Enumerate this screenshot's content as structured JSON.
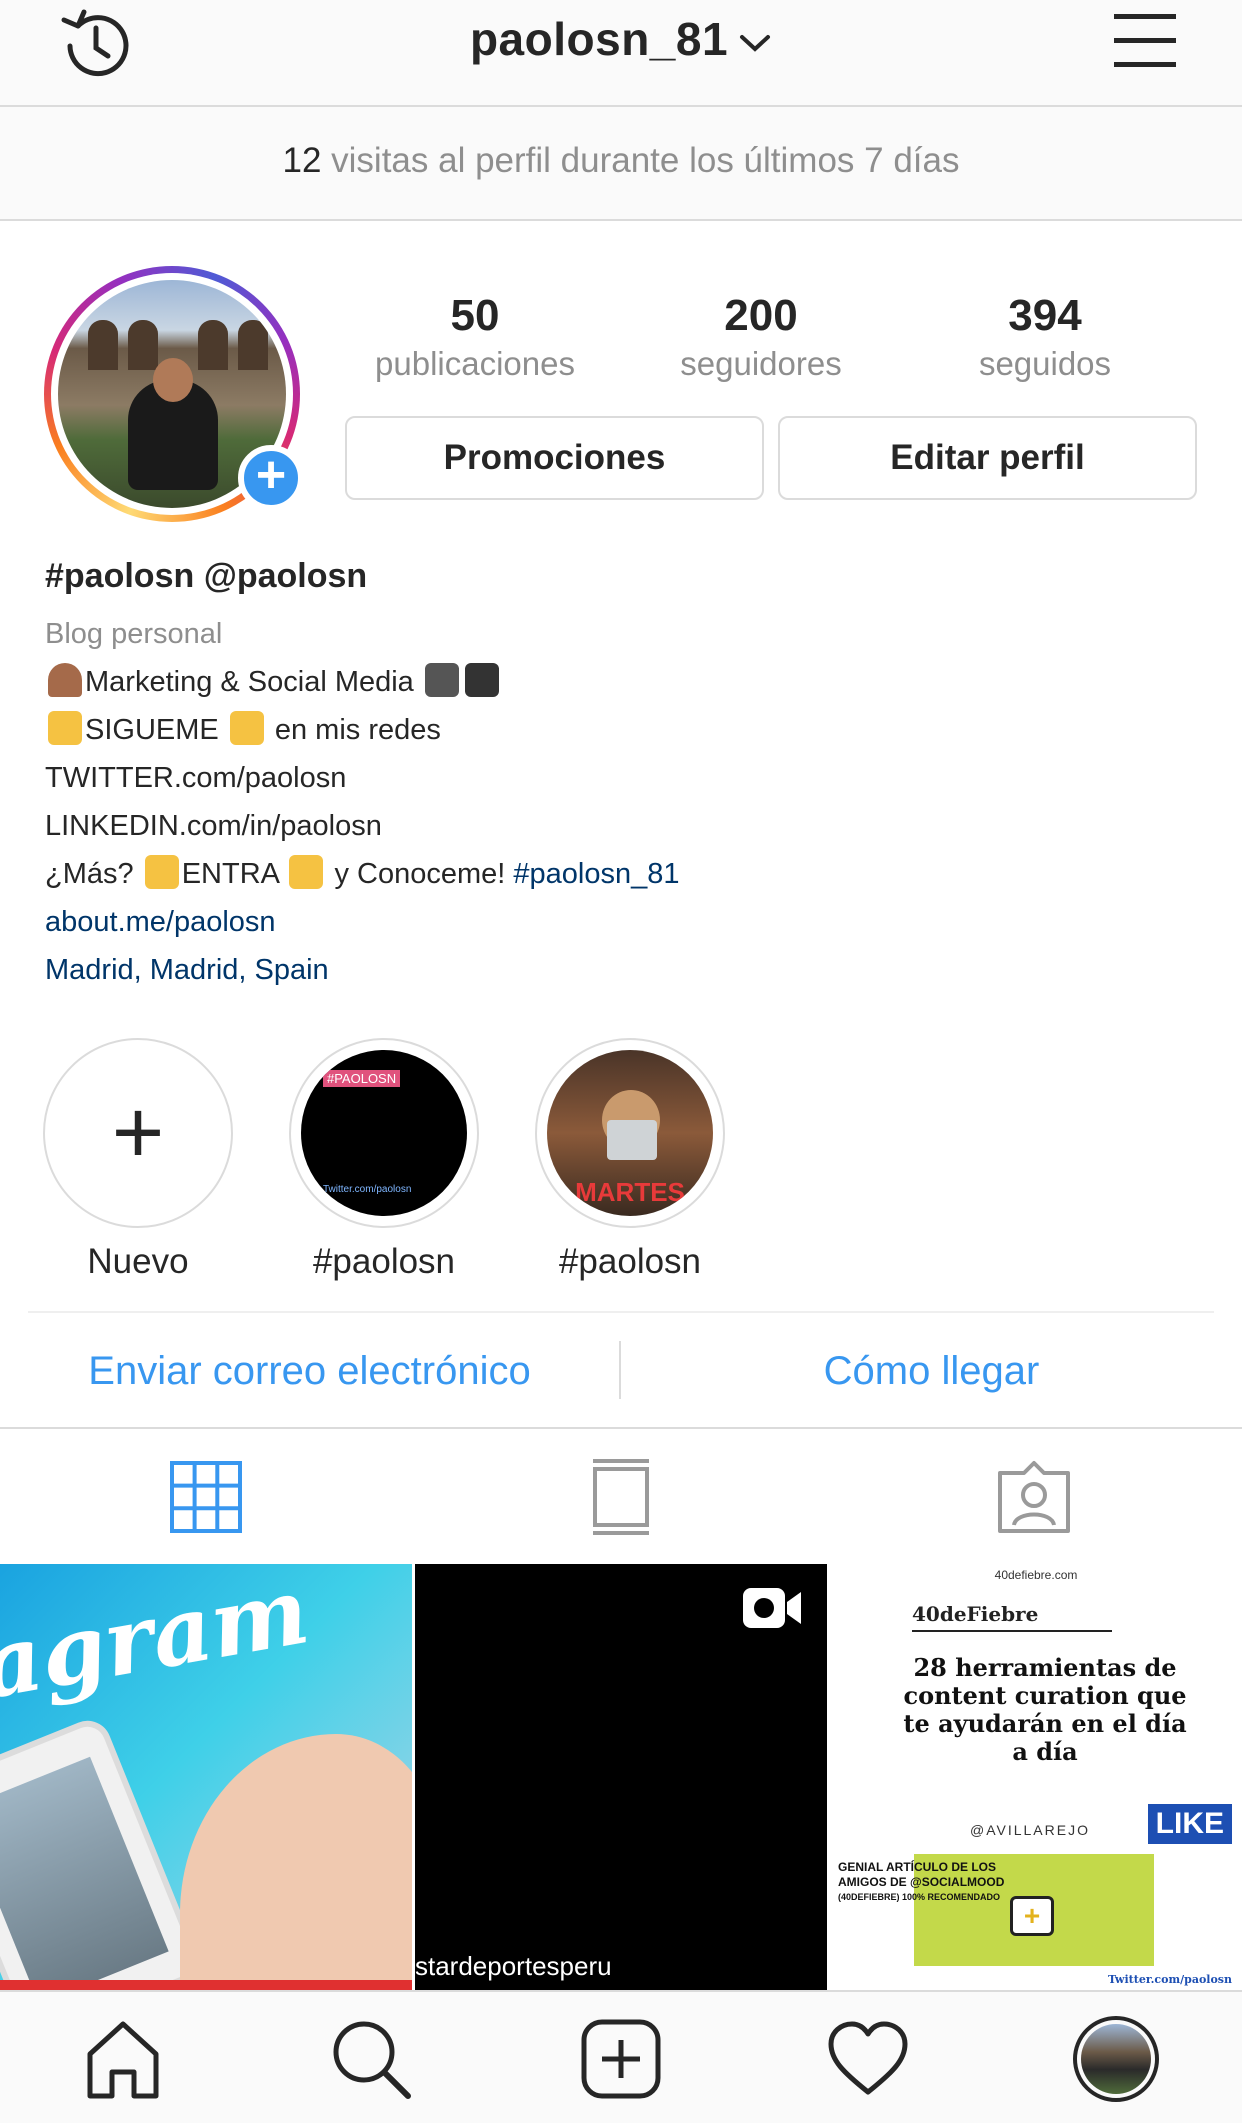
{
  "header": {
    "username": "paolosn_81"
  },
  "visits": {
    "count": "12",
    "text": " visitas al perfil durante los últimos 7 días"
  },
  "stats": [
    {
      "value": "50",
      "label": "publicaciones"
    },
    {
      "value": "200",
      "label": "seguidores"
    },
    {
      "value": "394",
      "label": "seguidos"
    }
  ],
  "buttons": {
    "promotions": "Promociones",
    "edit_profile": "Editar perfil"
  },
  "bio": {
    "name": "#paolosn @paolosn",
    "category": "Blog personal",
    "line1": "Marketing & Social Media",
    "line2a": "SIGUEME",
    "line2b": " en mis redes",
    "line3": "TWITTER.com/paolosn",
    "line4": "LINKEDIN.com/in/paolosn",
    "line5a": "¿Más? ",
    "line5b": "ENTRA ",
    "line5c": " y Conoceme! ",
    "line5_tag": "#paolosn_81",
    "website": "about.me/paolosn",
    "location": "Madrid, Madrid, Spain"
  },
  "highlights": [
    {
      "label": "Nuevo"
    },
    {
      "label": "#paolosn",
      "cover_text": "#PAOLOSN",
      "cover_footer": "Twitter.com/paolosn"
    },
    {
      "label": "#paolosn",
      "cover_text": "MARTES"
    }
  ],
  "contact": {
    "email": "Enviar correo electrónico",
    "directions": "Cómo llegar"
  },
  "posts": [
    {
      "text": "agram"
    },
    {
      "caption": "stardeportesperu"
    },
    {
      "url": "40defiebre.com",
      "brand": "40deFiebre",
      "headline": "28 herramientas de content curation que te ayudarán en el día a día",
      "handle": "@AVILLAREJO",
      "like": "LIKE",
      "note1": "GENIAL ARTÍCULO DE LOS",
      "note2": "AMIGOS DE @SOCIALMOOD",
      "note3": "(40DEFIEBRE) 100% RECOMENDADO",
      "footer": "Twitter.com/paolosn"
    }
  ],
  "colors": {
    "accent": "#3897f0",
    "link": "#003569",
    "text": "#262626",
    "muted": "#8e8e8e"
  }
}
